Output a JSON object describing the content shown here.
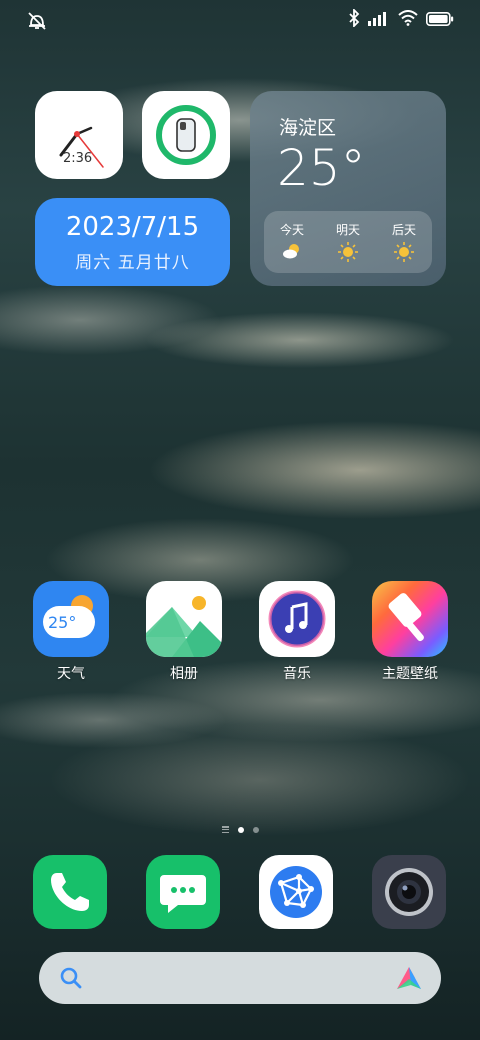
{
  "clock_widget": {
    "time": "2:36"
  },
  "date_widget": {
    "date": "2023/7/15",
    "lunar": "周六 五月廿八"
  },
  "weather_widget": {
    "city": "海淀区",
    "temperature": "25°",
    "forecast": [
      {
        "day": "今天",
        "icon": "partly-cloudy-icon"
      },
      {
        "day": "明天",
        "icon": "sunny-icon"
      },
      {
        "day": "后天",
        "icon": "sunny-icon"
      }
    ]
  },
  "apps": [
    {
      "label": "天气",
      "icon": "weather-icon",
      "badge": "25°"
    },
    {
      "label": "相册",
      "icon": "gallery-icon"
    },
    {
      "label": "音乐",
      "icon": "music-icon"
    },
    {
      "label": "主题壁纸",
      "icon": "themes-icon"
    }
  ],
  "dock": [
    {
      "icon": "phone-icon"
    },
    {
      "icon": "messages-icon"
    },
    {
      "icon": "browser-icon"
    },
    {
      "icon": "camera-icon"
    }
  ],
  "colors": {
    "date_widget_bg": "#3a8ff6",
    "phone_green": "#17c06a",
    "search_icon": "#3a8ff6"
  }
}
